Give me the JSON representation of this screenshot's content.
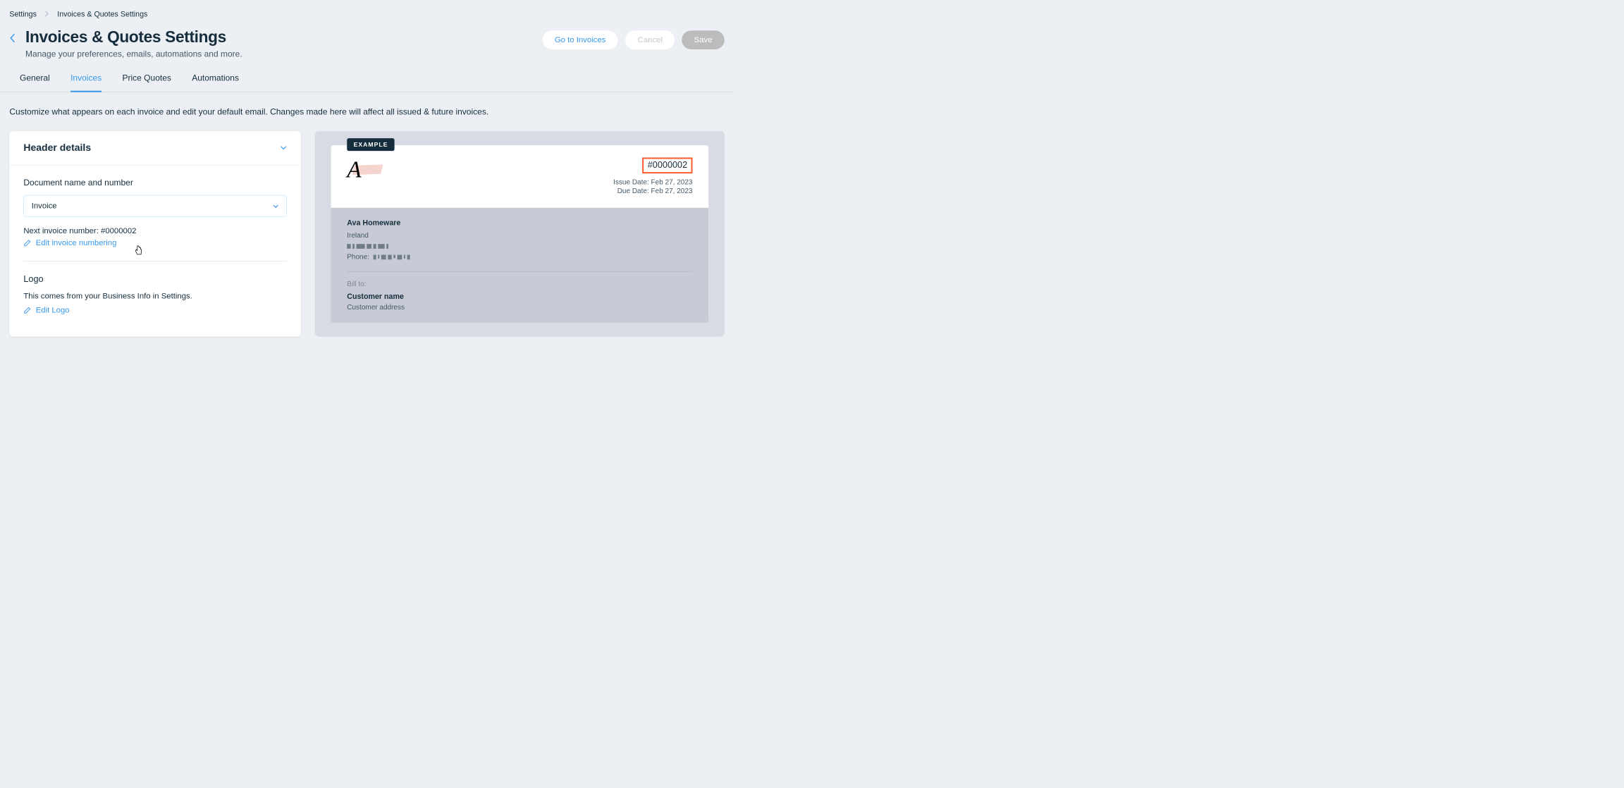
{
  "breadcrumb": {
    "root": "Settings",
    "current": "Invoices & Quotes Settings"
  },
  "header": {
    "title": "Invoices & Quotes Settings",
    "subtitle": "Manage your preferences, emails, automations and more.",
    "go_to_invoices": "Go to Invoices",
    "cancel": "Cancel",
    "save": "Save"
  },
  "tabs": {
    "general": "General",
    "invoices": "Invoices",
    "price_quotes": "Price Quotes",
    "automations": "Automations"
  },
  "description": "Customize what appears on each invoice and edit your default email. Changes made here will affect all issued & future invoices.",
  "panel": {
    "title": "Header details",
    "doc_label": "Document name and number",
    "doc_value": "Invoice",
    "next_number": "Next invoice number: #0000002",
    "edit_numbering": "Edit invoice numbering",
    "logo_title": "Logo",
    "logo_text": "This comes from your Business Info in Settings.",
    "edit_logo": "Edit Logo"
  },
  "example": {
    "badge": "EXAMPLE",
    "invoice_number": "#0000002",
    "issue_date": "Issue Date: Feb 27, 2023",
    "due_date": "Due Date: Feb 27, 2023",
    "company": "Ava Homeware",
    "country": "Ireland",
    "phone_label": "Phone:",
    "bill_to": "Bill to:",
    "customer_name": "Customer name",
    "customer_address": "Customer address"
  }
}
